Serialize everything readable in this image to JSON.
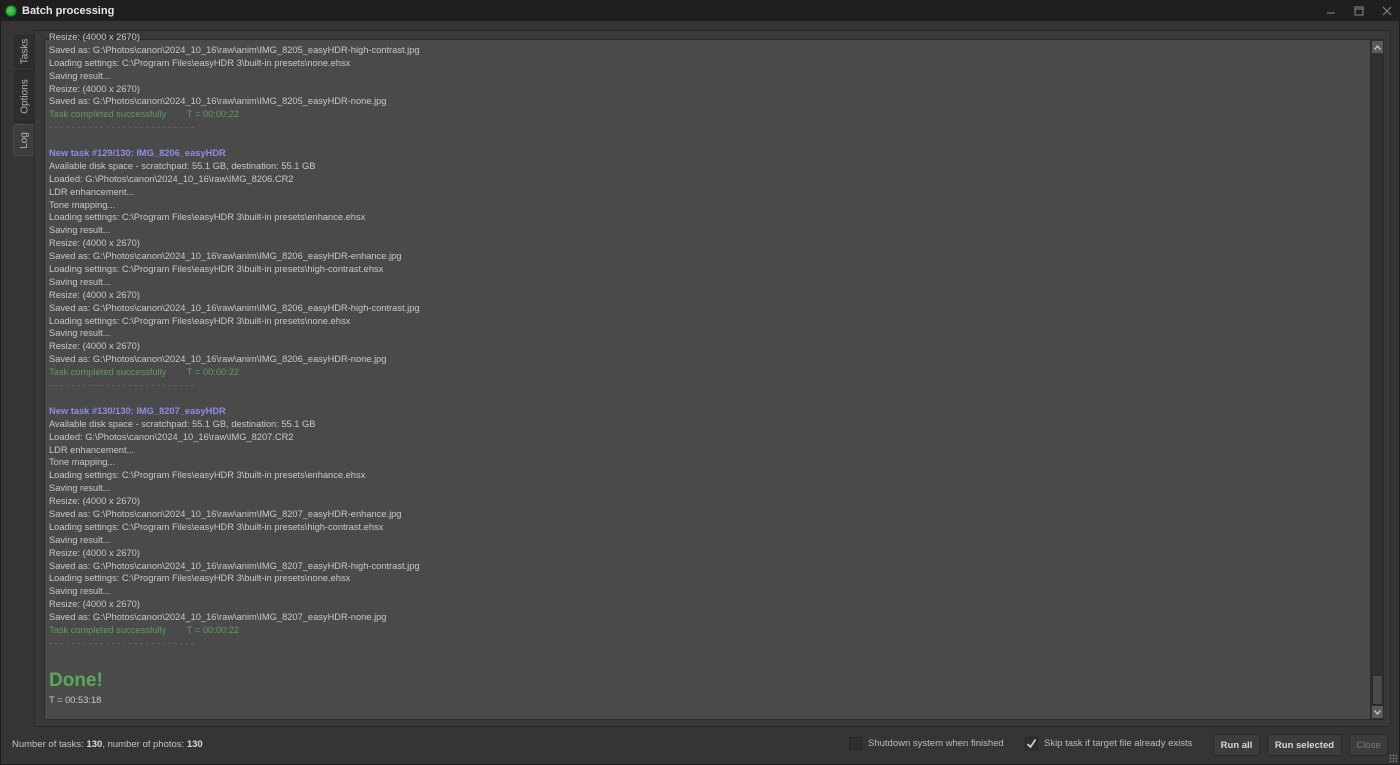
{
  "window": {
    "title": "Batch processing",
    "controls": [
      "minimize",
      "maximize",
      "close"
    ]
  },
  "tabs": [
    {
      "label": "Tasks",
      "active": false
    },
    {
      "label": "Options",
      "active": false
    },
    {
      "label": "Log",
      "active": true
    }
  ],
  "log": {
    "lines": [
      {
        "type": "info",
        "text": "Resize: (4000 x 2670)"
      },
      {
        "type": "info",
        "text": "Saved as: G:\\Photos\\canon\\2024_10_16\\raw\\anim\\IMG_8205_easyHDR-high-contrast.jpg"
      },
      {
        "type": "info",
        "text": "Loading settings: C:\\Program Files\\easyHDR 3\\built-in presets\\none.ehsx"
      },
      {
        "type": "info",
        "text": "Saving result..."
      },
      {
        "type": "info",
        "text": "Resize: (4000 x 2670)"
      },
      {
        "type": "info",
        "text": "Saved as: G:\\Photos\\canon\\2024_10_16\\raw\\anim\\IMG_8205_easyHDR-none.jpg"
      },
      {
        "type": "ok",
        "text": "Task completed successfully        T = 00:00:22"
      },
      {
        "type": "sep",
        "text": "- - - - - - - - - - - - - - - - - - - - - - - - - -"
      },
      {
        "type": "blank",
        "text": ""
      },
      {
        "type": "task",
        "text": "New task #129/130: IMG_8206_easyHDR"
      },
      {
        "type": "info",
        "text": "Available disk space - scratchpad: 55.1 GB, destination: 55.1 GB"
      },
      {
        "type": "info",
        "text": "Loaded: G:\\Photos\\canon\\2024_10_16\\raw\\IMG_8206.CR2"
      },
      {
        "type": "info",
        "text": "LDR enhancement..."
      },
      {
        "type": "info",
        "text": "Tone mapping..."
      },
      {
        "type": "info",
        "text": "Loading settings: C:\\Program Files\\easyHDR 3\\built-in presets\\enhance.ehsx"
      },
      {
        "type": "info",
        "text": "Saving result..."
      },
      {
        "type": "info",
        "text": "Resize: (4000 x 2670)"
      },
      {
        "type": "info",
        "text": "Saved as: G:\\Photos\\canon\\2024_10_16\\raw\\anim\\IMG_8206_easyHDR-enhance.jpg"
      },
      {
        "type": "info",
        "text": "Loading settings: C:\\Program Files\\easyHDR 3\\built-in presets\\high-contrast.ehsx"
      },
      {
        "type": "info",
        "text": "Saving result..."
      },
      {
        "type": "info",
        "text": "Resize: (4000 x 2670)"
      },
      {
        "type": "info",
        "text": "Saved as: G:\\Photos\\canon\\2024_10_16\\raw\\anim\\IMG_8206_easyHDR-high-contrast.jpg"
      },
      {
        "type": "info",
        "text": "Loading settings: C:\\Program Files\\easyHDR 3\\built-in presets\\none.ehsx"
      },
      {
        "type": "info",
        "text": "Saving result..."
      },
      {
        "type": "info",
        "text": "Resize: (4000 x 2670)"
      },
      {
        "type": "info",
        "text": "Saved as: G:\\Photos\\canon\\2024_10_16\\raw\\anim\\IMG_8206_easyHDR-none.jpg"
      },
      {
        "type": "ok",
        "text": "Task completed successfully        T = 00:00:22"
      },
      {
        "type": "sep",
        "text": "- - - - - - - - - - - - - - - - - - - - - - - - - -"
      },
      {
        "type": "blank",
        "text": ""
      },
      {
        "type": "task",
        "text": "New task #130/130: IMG_8207_easyHDR"
      },
      {
        "type": "info",
        "text": "Available disk space - scratchpad: 55.1 GB, destination: 55.1 GB"
      },
      {
        "type": "info",
        "text": "Loaded: G:\\Photos\\canon\\2024_10_16\\raw\\IMG_8207.CR2"
      },
      {
        "type": "info",
        "text": "LDR enhancement..."
      },
      {
        "type": "info",
        "text": "Tone mapping..."
      },
      {
        "type": "info",
        "text": "Loading settings: C:\\Program Files\\easyHDR 3\\built-in presets\\enhance.ehsx"
      },
      {
        "type": "info",
        "text": "Saving result..."
      },
      {
        "type": "info",
        "text": "Resize: (4000 x 2670)"
      },
      {
        "type": "info",
        "text": "Saved as: G:\\Photos\\canon\\2024_10_16\\raw\\anim\\IMG_8207_easyHDR-enhance.jpg"
      },
      {
        "type": "info",
        "text": "Loading settings: C:\\Program Files\\easyHDR 3\\built-in presets\\high-contrast.ehsx"
      },
      {
        "type": "info",
        "text": "Saving result..."
      },
      {
        "type": "info",
        "text": "Resize: (4000 x 2670)"
      },
      {
        "type": "info",
        "text": "Saved as: G:\\Photos\\canon\\2024_10_16\\raw\\anim\\IMG_8207_easyHDR-high-contrast.jpg"
      },
      {
        "type": "info",
        "text": "Loading settings: C:\\Program Files\\easyHDR 3\\built-in presets\\none.ehsx"
      },
      {
        "type": "info",
        "text": "Saving result..."
      },
      {
        "type": "info",
        "text": "Resize: (4000 x 2670)"
      },
      {
        "type": "info",
        "text": "Saved as: G:\\Photos\\canon\\2024_10_16\\raw\\anim\\IMG_8207_easyHDR-none.jpg"
      },
      {
        "type": "ok",
        "text": "Task completed successfully        T = 00:00:22"
      },
      {
        "type": "sep",
        "text": "- - - - - - - - - - - - - - - - - - - - - - - - - -"
      },
      {
        "type": "blank",
        "text": ""
      },
      {
        "type": "done",
        "text": "Done!"
      },
      {
        "type": "info",
        "text": "T = 00:53:18"
      }
    ]
  },
  "footer": {
    "tasks_label": "Number of tasks: ",
    "tasks_count": "130",
    "photos_label": ", number of photos: ",
    "photos_count": "130",
    "shutdown_label": "Shutdown system when finished",
    "shutdown_checked": false,
    "skip_label": "Skip task if target file already exists",
    "skip_checked": true,
    "run_all_label": "Run all",
    "run_selected_label": "Run selected",
    "close_label": "Close"
  },
  "colors": {
    "task_header": "#8e8ee0",
    "success": "#5e9e5e",
    "done": "#5aa85a"
  }
}
